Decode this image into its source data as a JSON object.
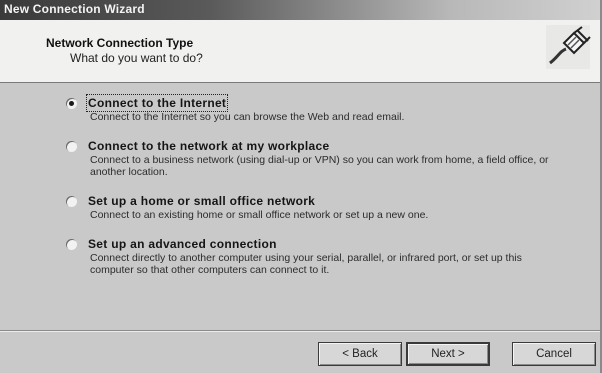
{
  "window": {
    "title": "New Connection Wizard"
  },
  "header": {
    "title": "Network Connection Type",
    "subtitle": "What do you want to do?",
    "icon": "network-plug-icon"
  },
  "options": [
    {
      "label": "Connect to the Internet",
      "description": "Connect to the Internet so you can browse the Web and read email.",
      "checked": true
    },
    {
      "label": "Connect to the network at my workplace",
      "description": "Connect to a business network (using dial-up or VPN) so you can work from home, a field office, or another location.",
      "checked": false
    },
    {
      "label": "Set up a home or small office network",
      "description": "Connect to an existing home or small office network or set up a new one.",
      "checked": false
    },
    {
      "label": "Set up an advanced connection",
      "description": "Connect directly to another computer using your serial, parallel, or infrared port, or set up this computer so that other computers can connect to it.",
      "checked": false
    }
  ],
  "buttons": {
    "back": "< Back",
    "next": "Next >",
    "cancel": "Cancel"
  }
}
